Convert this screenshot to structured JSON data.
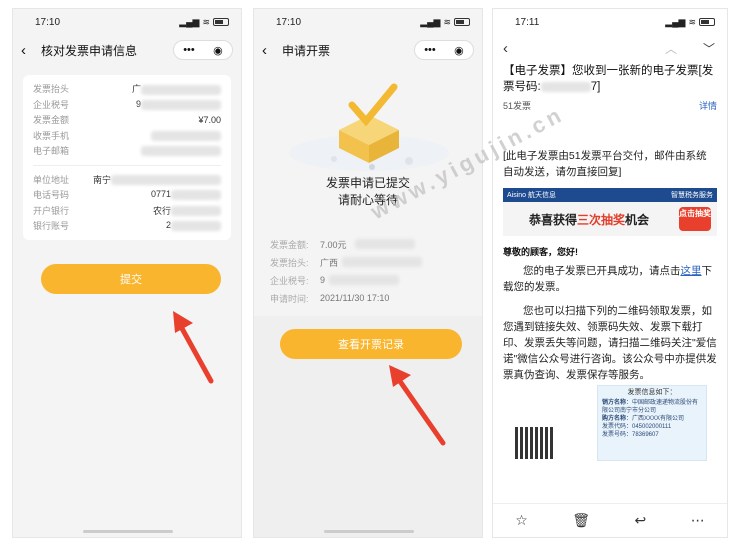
{
  "screen1": {
    "time": "17:10",
    "title": "核对发票申请信息",
    "fields": [
      {
        "label": "发票抬头",
        "value": "广"
      },
      {
        "label": "企业税号",
        "value": "9"
      },
      {
        "label": "发票金额",
        "value": "¥7.00"
      },
      {
        "label": "收票手机",
        "value": ""
      },
      {
        "label": "电子邮箱",
        "value": ""
      }
    ],
    "fields2": [
      {
        "label": "单位地址",
        "value": "南宁"
      },
      {
        "label": "电话号码",
        "value": "0771"
      },
      {
        "label": "开户银行",
        "value": "农行"
      },
      {
        "label": "银行账号",
        "value": "2"
      }
    ],
    "submit_label": "提交"
  },
  "screen2": {
    "time": "17:10",
    "title": "申请开票",
    "status_line1": "发票申请已提交",
    "status_line2": "请耐心等待",
    "info": [
      {
        "label": "发票金额:",
        "value": "7.00元"
      },
      {
        "label": "发票抬头:",
        "value": "广西"
      },
      {
        "label": "企业税号:",
        "value": "9"
      },
      {
        "label": "申请时间:",
        "value": "2021/11/30 17:10"
      }
    ],
    "records_label": "查看开票记录"
  },
  "screen3": {
    "time": "17:11",
    "subject_line1": "【电子发票】您收到一张新的电子发票[发",
    "subject_line2_prefix": "票号码:",
    "subject_line2_suffix": "7]",
    "sender": "51发票",
    "details_label": "详情",
    "intro": "[此电子发票由51发票平台交付，邮件由系统自动发送，请勿直接回复]",
    "banner_brand": "Aisino 航天信息",
    "banner_right": "智慧税务服务",
    "promo_prefix": "恭喜获得",
    "promo_highlight": "三次抽奖",
    "promo_suffix": "机会",
    "promo_badge": "点击抽奖",
    "greeting": "尊敬的顾客，您好!",
    "para1_a": "您的电子发票已开具成功，请点击",
    "para1_link": "这里",
    "para1_b": "下载您的发票。",
    "para2": "您也可以扫描下列的二维码领取发票，如您遇到链接失效、领票码失效、发票下载打印、发票丢失等问题，请扫描二维码关注\"爱信诺\"微信公众号进行咨询。该公众号中亦提供发票真伪查询、发票保存等服务。",
    "invoice_box": {
      "title": "发票信息如下：",
      "seller_label": "销方名称",
      "seller": "：中国邮政速递物流股份有限公司南宁市分公司",
      "buyer_label": "购方名称",
      "buyer": "：广西XXXX有限公司",
      "code": "发票代码：045002000111",
      "number": "发票号码：78369607"
    }
  },
  "watermark": "www.yigujin.cn",
  "colors": {
    "accent": "#f8b52d",
    "link": "#2a63c4",
    "arrow": "#e8402d"
  }
}
